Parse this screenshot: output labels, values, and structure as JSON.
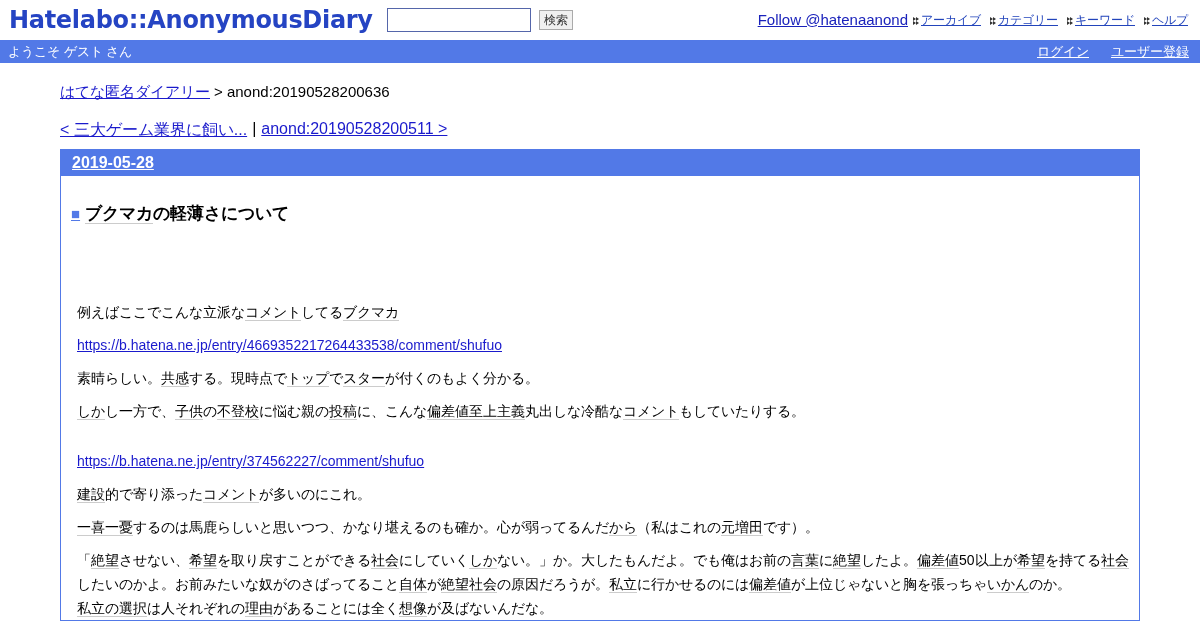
{
  "header": {
    "logo": "Hatelabo::AnonymousDiary",
    "search": {
      "button": "検索"
    },
    "follow": "Follow @hatenaanond",
    "nav": [
      "アーカイブ",
      "カテゴリー",
      "キーワード",
      "ヘルプ"
    ]
  },
  "user_bar": {
    "welcome": "ようこそ ゲスト さん",
    "links": [
      "ログイン",
      "ユーザー登録"
    ]
  },
  "breadcrumb": {
    "home": "はてな匿名ダイアリー",
    "current": "> anond:20190528200636"
  },
  "pager": {
    "prev": "< 三大ゲーム業界に飼い...",
    "separator": "|",
    "next": "anond:20190528200511 >"
  },
  "day": {
    "date": "2019-05-28",
    "title": {
      "mark": "■",
      "segments": [
        {
          "text": "ブクマカ",
          "keyword": true
        },
        {
          "text": "の軽薄さについて",
          "keyword": false
        }
      ]
    },
    "paragraphs": [
      {
        "kind": "text",
        "segments": [
          {
            "text": "例えばここでこんな立派な",
            "keyword": false
          },
          {
            "text": "コメント",
            "keyword": true
          },
          {
            "text": "してる",
            "keyword": false
          },
          {
            "text": "ブクマカ",
            "keyword": true
          }
        ]
      },
      {
        "kind": "link",
        "text": "https://b.hatena.ne.jp/entry/4669352217264433538/comment/shufuo"
      },
      {
        "kind": "text",
        "segments": [
          {
            "text": "素晴らしい。",
            "keyword": false
          },
          {
            "text": "共感",
            "keyword": true
          },
          {
            "text": "する。現時点で",
            "keyword": false
          },
          {
            "text": "トップ",
            "keyword": true
          },
          {
            "text": "で",
            "keyword": false
          },
          {
            "text": "スター",
            "keyword": true
          },
          {
            "text": "が付くのもよく分かる。",
            "keyword": false
          }
        ]
      },
      {
        "kind": "text",
        "segments": [
          {
            "text": "しか",
            "keyword": true
          },
          {
            "text": "し一方で、",
            "keyword": false
          },
          {
            "text": "子供",
            "keyword": true
          },
          {
            "text": "の",
            "keyword": false
          },
          {
            "text": "不登校",
            "keyword": true
          },
          {
            "text": "に悩む親の",
            "keyword": false
          },
          {
            "text": "投稿",
            "keyword": true
          },
          {
            "text": "に、こんな",
            "keyword": false
          },
          {
            "text": "偏差値至上主義",
            "keyword": true
          },
          {
            "text": "丸出しな冷酷な",
            "keyword": false
          },
          {
            "text": "コメント",
            "keyword": true
          },
          {
            "text": "もしていたりする。",
            "keyword": false
          }
        ]
      },
      {
        "kind": "blank"
      },
      {
        "kind": "link",
        "text": "https://b.hatena.ne.jp/entry/374562227/comment/shufuo"
      },
      {
        "kind": "text",
        "segments": [
          {
            "text": "建設",
            "keyword": true
          },
          {
            "text": "的で寄り添った",
            "keyword": false
          },
          {
            "text": "コメント",
            "keyword": true
          },
          {
            "text": "が多いのにこれ。",
            "keyword": false
          }
        ]
      },
      {
        "kind": "text",
        "segments": [
          {
            "text": "一喜一憂",
            "keyword": true
          },
          {
            "text": "するのは馬鹿らしいと思いつつ、かなり堪えるのも確か。心が弱ってるんだ",
            "keyword": false
          },
          {
            "text": "から",
            "keyword": true
          },
          {
            "text": "（私はこれの",
            "keyword": false
          },
          {
            "text": "元増田",
            "keyword": true
          },
          {
            "text": "です）。",
            "keyword": false
          }
        ]
      },
      {
        "kind": "text",
        "segments": [
          {
            "text": "「",
            "keyword": false
          },
          {
            "text": "絶望",
            "keyword": true
          },
          {
            "text": "させない、",
            "keyword": false
          },
          {
            "text": "希望",
            "keyword": true
          },
          {
            "text": "を取り戻すことができる",
            "keyword": false
          },
          {
            "text": "社会",
            "keyword": true
          },
          {
            "text": "にしていく",
            "keyword": false
          },
          {
            "text": "しか",
            "keyword": true
          },
          {
            "text": "ない。」か。大したもんだよ。でも俺はお前の",
            "keyword": false
          },
          {
            "text": "言葉",
            "keyword": true
          },
          {
            "text": "に",
            "keyword": false
          },
          {
            "text": "絶望",
            "keyword": true
          },
          {
            "text": "したよ。",
            "keyword": false
          },
          {
            "text": "偏差値",
            "keyword": true
          },
          {
            "text": "50以上が",
            "keyword": false
          },
          {
            "text": "希望",
            "keyword": true
          },
          {
            "text": "を持てる",
            "keyword": false
          },
          {
            "text": "社会",
            "keyword": true
          },
          {
            "text": "したいのかよ。お前みたいな奴がのさばってること",
            "keyword": false
          },
          {
            "text": "自体",
            "keyword": true
          },
          {
            "text": "が",
            "keyword": false
          },
          {
            "text": "絶望社会",
            "keyword": true
          },
          {
            "text": "の原因だろうが。",
            "keyword": false
          },
          {
            "text": "私立",
            "keyword": true
          },
          {
            "text": "に行かせるのには",
            "keyword": false
          },
          {
            "text": "偏差値",
            "keyword": true
          },
          {
            "text": "が上位じゃないと胸を張っちゃ",
            "keyword": false
          },
          {
            "text": "いかん",
            "keyword": true
          },
          {
            "text": "のか。",
            "keyword": false
          },
          {
            "text": "私立の選択",
            "keyword": true
          },
          {
            "text": "は人それぞれの",
            "keyword": false
          },
          {
            "text": "理由",
            "keyword": true
          },
          {
            "text": "があることには全く",
            "keyword": false
          },
          {
            "text": "想像",
            "keyword": true
          },
          {
            "text": "が及ばないんだな。",
            "keyword": false
          }
        ]
      }
    ]
  }
}
